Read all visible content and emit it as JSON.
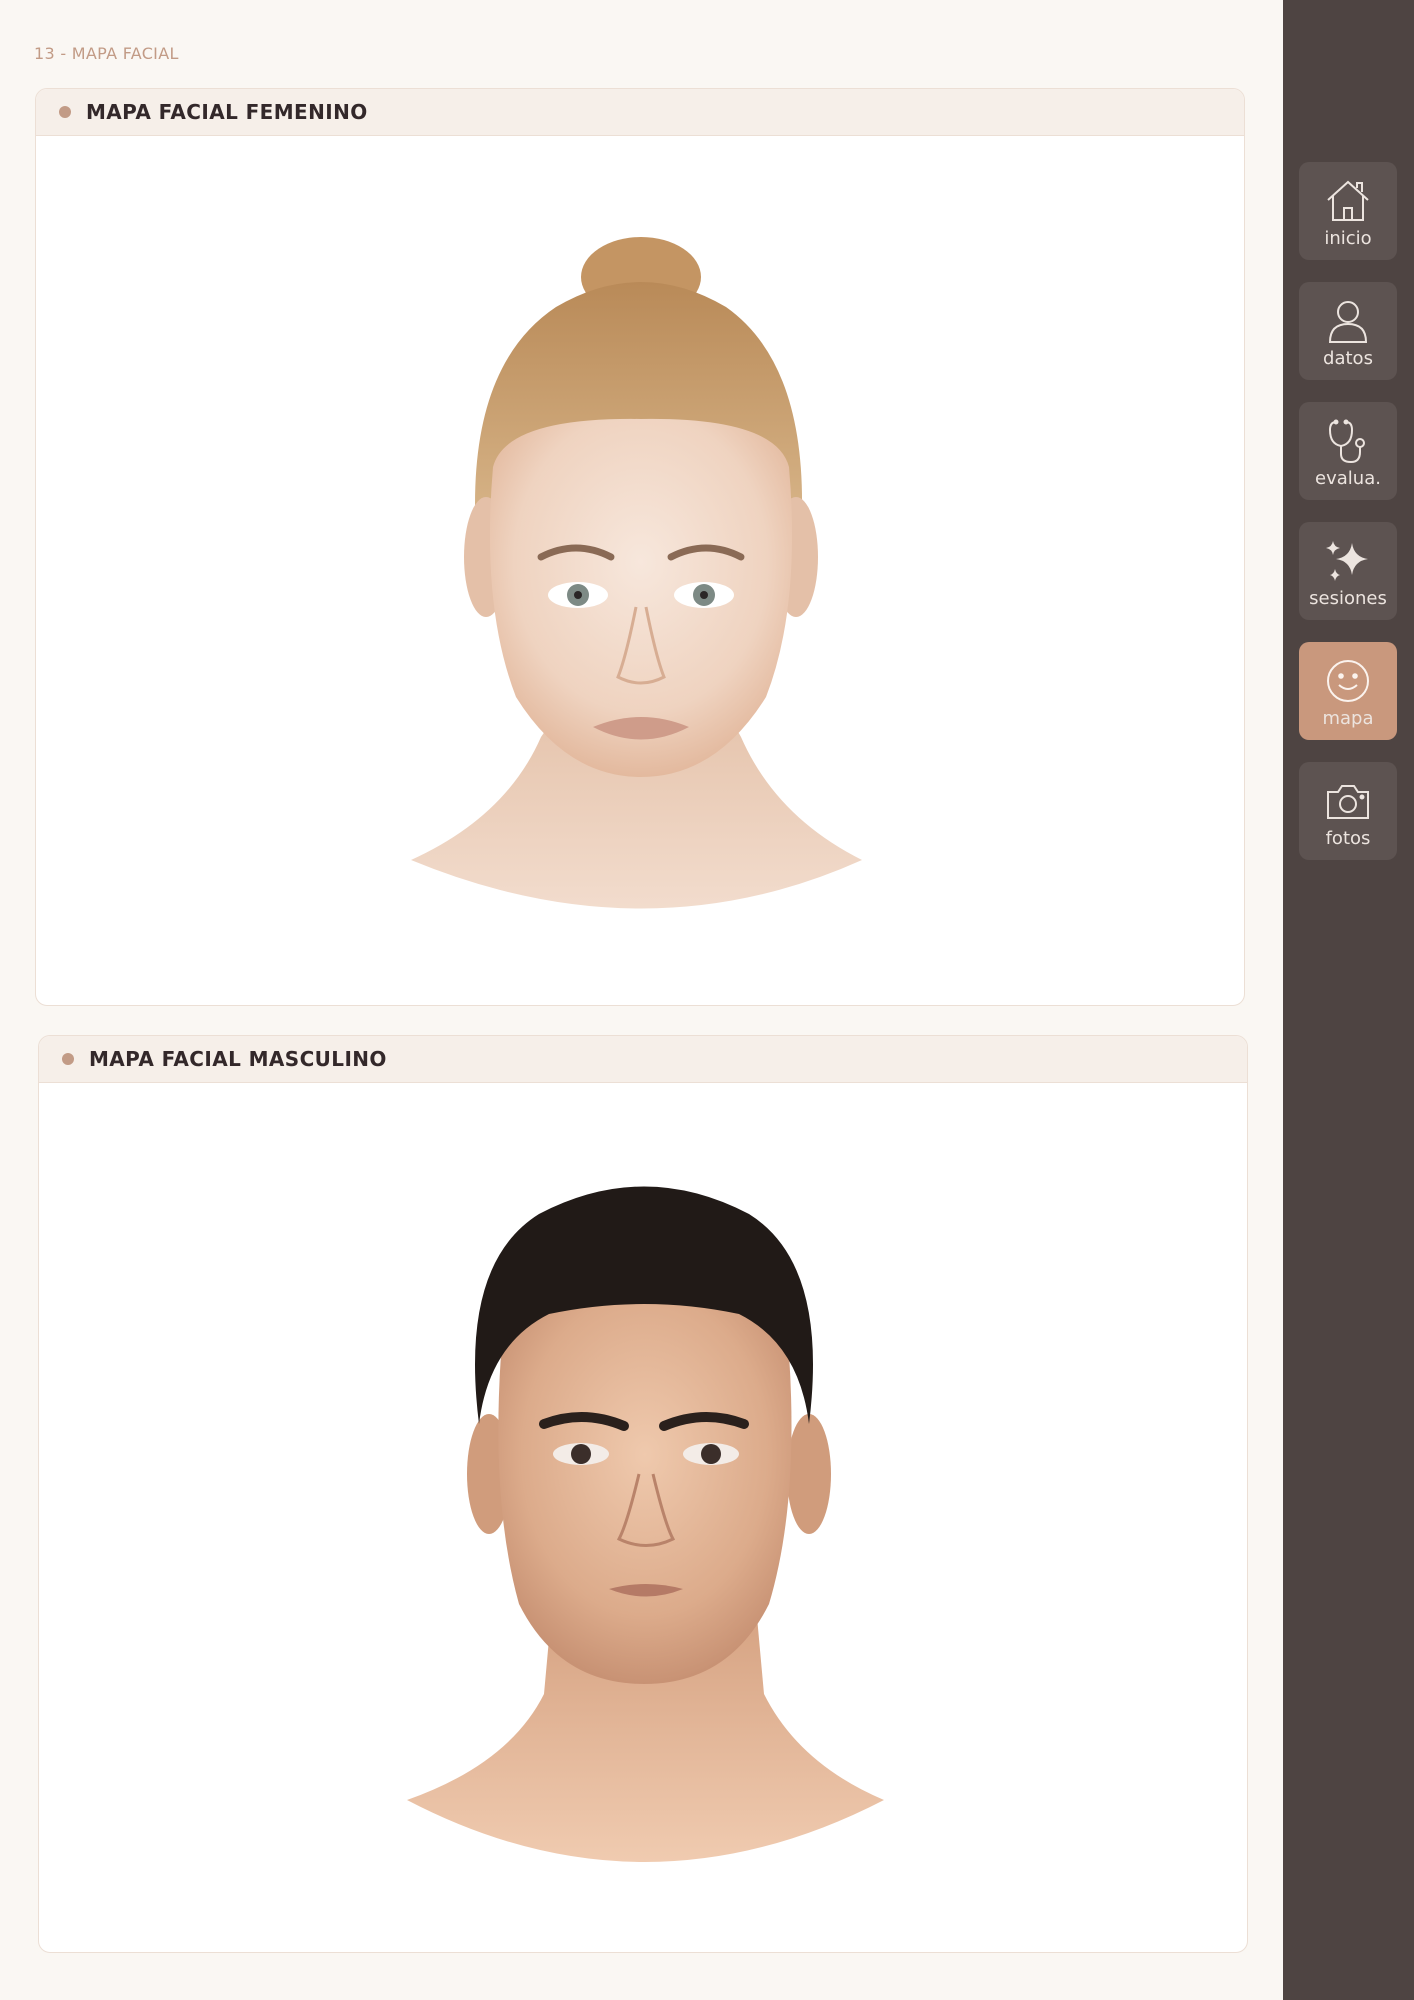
{
  "page": {
    "label": "13 - MAPA FACIAL"
  },
  "sections": {
    "female": {
      "title": "MAPA FACIAL FEMENINO"
    },
    "male": {
      "title": "MAPA FACIAL MASCULINO"
    }
  },
  "sidebar": {
    "items": [
      {
        "label": "inicio",
        "icon": "home-icon"
      },
      {
        "label": "datos",
        "icon": "user-icon"
      },
      {
        "label": "evalua.",
        "icon": "stethoscope-icon"
      },
      {
        "label": "sesiones",
        "icon": "sparkles-icon"
      },
      {
        "label": "mapa",
        "icon": "smiley-icon",
        "active": true
      },
      {
        "label": "fotos",
        "icon": "camera-icon"
      }
    ]
  },
  "colors": {
    "background": "#faf7f3",
    "accent": "#c9987d",
    "sidebar": "#4e4442",
    "header": "#f6efe9",
    "title_text": "#33282a"
  }
}
